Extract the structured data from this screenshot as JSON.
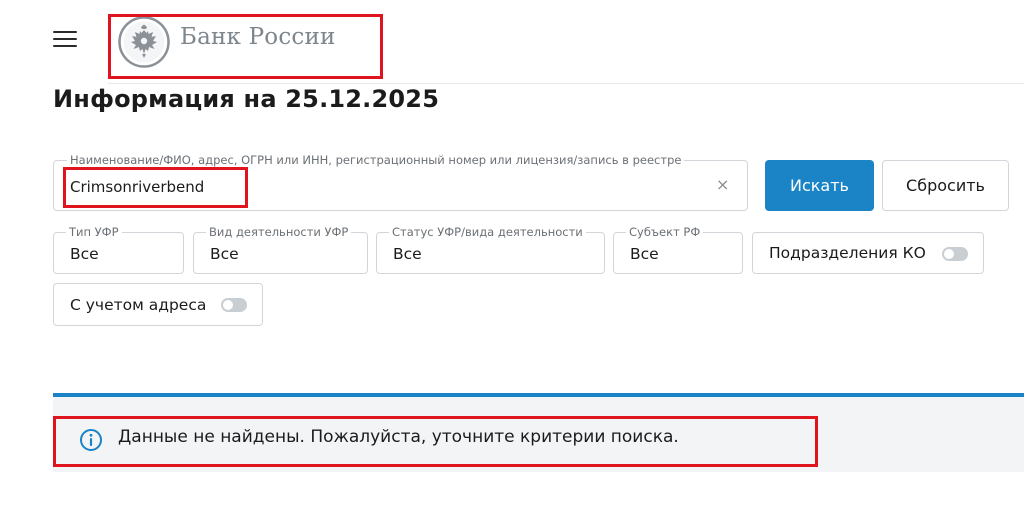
{
  "header": {
    "logo_text": "Банк России",
    "brand_color": "#1a84c7",
    "highlight_color": "#e0141e"
  },
  "page": {
    "title": "Информация на 25.12.2025"
  },
  "search": {
    "label": "Наименование/ФИО, адрес, ОГРН или ИНН, регистрационный номер или лицензия/запись в реестре",
    "value": "Crimsonriverbend",
    "clear_symbol": "×",
    "search_button": "Искать",
    "reset_button": "Сбросить"
  },
  "filters": {
    "type": {
      "label": "Тип УФР",
      "value": "Все"
    },
    "kind": {
      "label": "Вид деятельности УФР",
      "value": "Все"
    },
    "status": {
      "label": "Статус УФР/вида деятельности",
      "value": "Все"
    },
    "subject": {
      "label": "Субъект РФ",
      "value": "Все"
    },
    "subdivisions": {
      "label": "Подразделения КО",
      "enabled": false
    },
    "with_address": {
      "label": "С учетом адреса",
      "enabled": false
    }
  },
  "result": {
    "message": "Данные не найдены. Пожалуйста, уточните критерии поиска.",
    "icon": "info-circle-icon"
  }
}
